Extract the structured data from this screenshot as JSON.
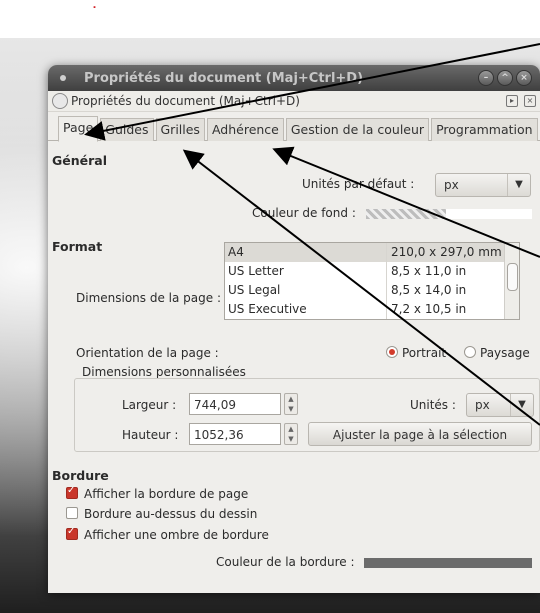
{
  "window": {
    "title": "Propriétés du document (Maj+Ctrl+D)",
    "dock_title": "Propriétés du document (Maj+Ctrl+D)"
  },
  "tabs": [
    {
      "label": "Page",
      "active": true
    },
    {
      "label": "Guides",
      "active": false
    },
    {
      "label": "Grilles",
      "active": false
    },
    {
      "label": "Adhérence",
      "active": false
    },
    {
      "label": "Gestion de la couleur",
      "active": false
    },
    {
      "label": "Programmation",
      "active": false
    }
  ],
  "general": {
    "title": "Général",
    "units_label": "Unités par défaut :",
    "units_value": "px",
    "background_label": "Couleur de fond :"
  },
  "format": {
    "title": "Format",
    "dimensions_label": "Dimensions de la page :",
    "sizes": [
      {
        "name": "A4",
        "dims": "210,0 x 297,0 mm",
        "selected": true
      },
      {
        "name": "US Letter",
        "dims": "8,5 x 11,0 in",
        "selected": false
      },
      {
        "name": "US Legal",
        "dims": "8,5 x 14,0 in",
        "selected": false
      },
      {
        "name": "US Executive",
        "dims": "7,2 x 10,5 in",
        "selected": false
      }
    ],
    "orientation_label": "Orientation de la page :",
    "portrait_label": "Portrait",
    "landscape_label": "Paysage",
    "orientation_value": "Portrait",
    "custom_title": "Dimensions personnalisées",
    "width_label": "Largeur :",
    "width_value": "744,09",
    "height_label": "Hauteur :",
    "height_value": "1052,36",
    "units_label": "Unités :",
    "units_value": "px",
    "fit_button": "Ajuster la page à la sélection"
  },
  "border": {
    "title": "Bordure",
    "show_border": {
      "label": "Afficher la bordure de page",
      "checked": true
    },
    "border_on_top": {
      "label": "Bordure au-dessus du dessin",
      "checked": false
    },
    "show_shadow": {
      "label": "Afficher une ombre de bordure",
      "checked": true
    },
    "color_label": "Couleur de la bordure :"
  },
  "colors": {
    "accent": "#d23a2a",
    "arrow": "#000000"
  }
}
